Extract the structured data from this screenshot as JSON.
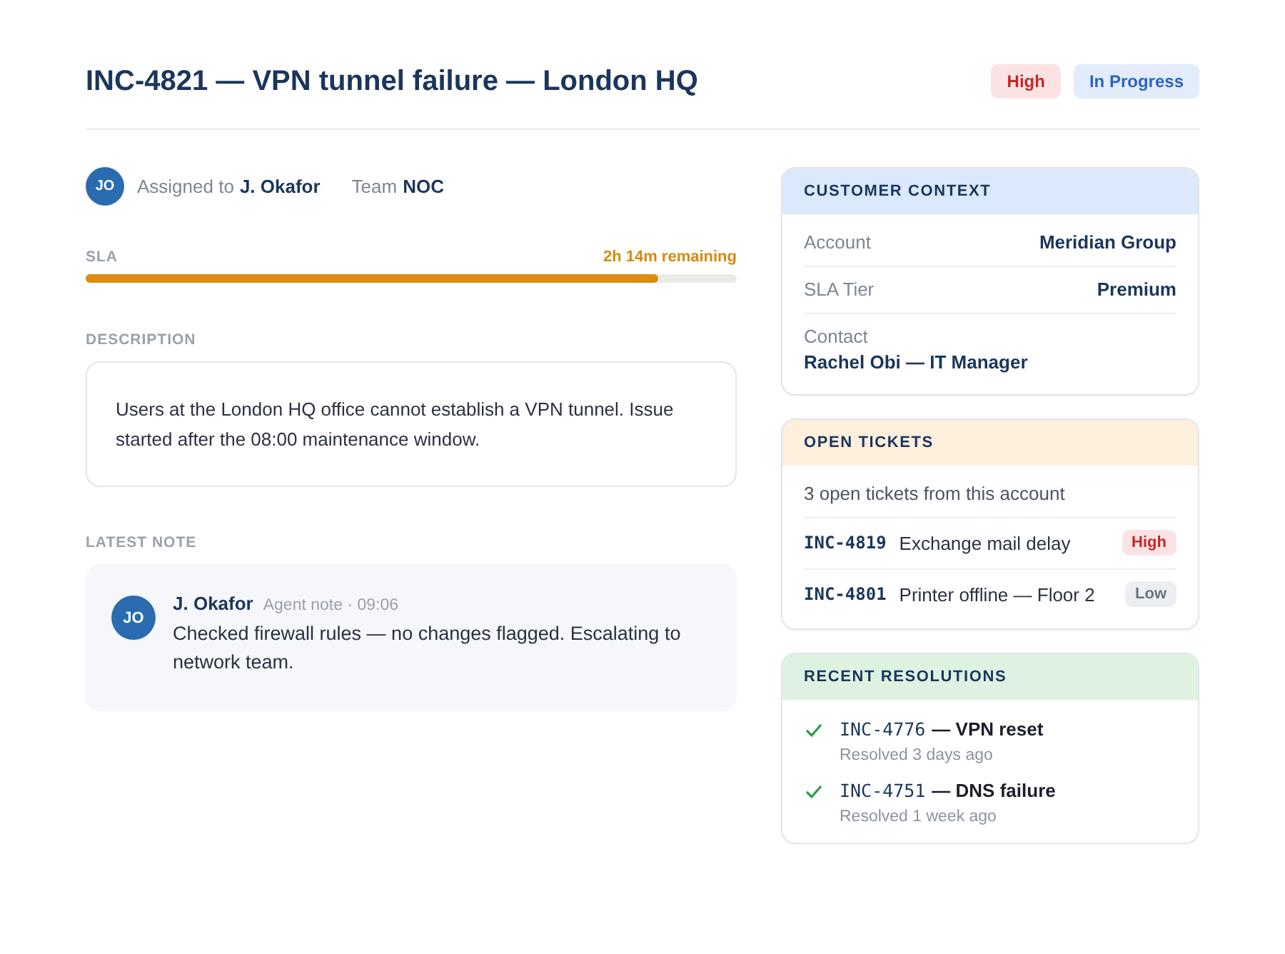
{
  "header": {
    "title": "INC-4821 — VPN tunnel failure — London HQ",
    "badges": [
      {
        "kind": "high",
        "label": "High"
      },
      {
        "kind": "status",
        "label": "In Progress"
      }
    ]
  },
  "assignment": {
    "avatar": "JO",
    "assigned_label": "Assigned to",
    "assignee": "J. Okafor",
    "team_label": "Team",
    "team": "NOC"
  },
  "sla": {
    "label": "SLA",
    "reading": "2h 14m remaining",
    "level": 0.88
  },
  "description": {
    "label": "DESCRIPTION",
    "text": "Users at the London HQ office cannot establish a VPN tunnel. Issue started after the 08:00 maintenance window."
  },
  "latest_note": {
    "label": "LATEST NOTE",
    "avatar": "JO",
    "author": "J. Okafor",
    "meta": "Agent note · 09:06",
    "text": "Checked firewall rules — no changes flagged. Escalating to network team."
  },
  "customer_context": {
    "title": "CUSTOMER CONTEXT",
    "fields": [
      {
        "kind": "inline",
        "label": "Account",
        "value": "Meridian Group"
      },
      {
        "kind": "inline",
        "label": "SLA Tier",
        "value": "Premium"
      },
      {
        "kind": "stacked",
        "label": "Contact",
        "value": "Rachel Obi — IT Manager"
      }
    ]
  },
  "open_tickets": {
    "title": "OPEN TICKETS",
    "summary": "3 open tickets from this account",
    "tickets": [
      {
        "id": "INC-4819",
        "title": "Exchange mail delay",
        "kind": "high",
        "label": "High"
      },
      {
        "id": "INC-4801",
        "title": "Printer offline — Floor 2",
        "kind": "low",
        "label": "Low"
      }
    ]
  },
  "recent_resolutions": {
    "title": "RECENT RESOLUTIONS",
    "items": [
      {
        "id": "INC-4776",
        "title": "— VPN reset",
        "when": "Resolved 3 days ago"
      },
      {
        "id": "INC-4751",
        "title": "— DNS failure",
        "when": "Resolved 1 week ago"
      }
    ]
  }
}
